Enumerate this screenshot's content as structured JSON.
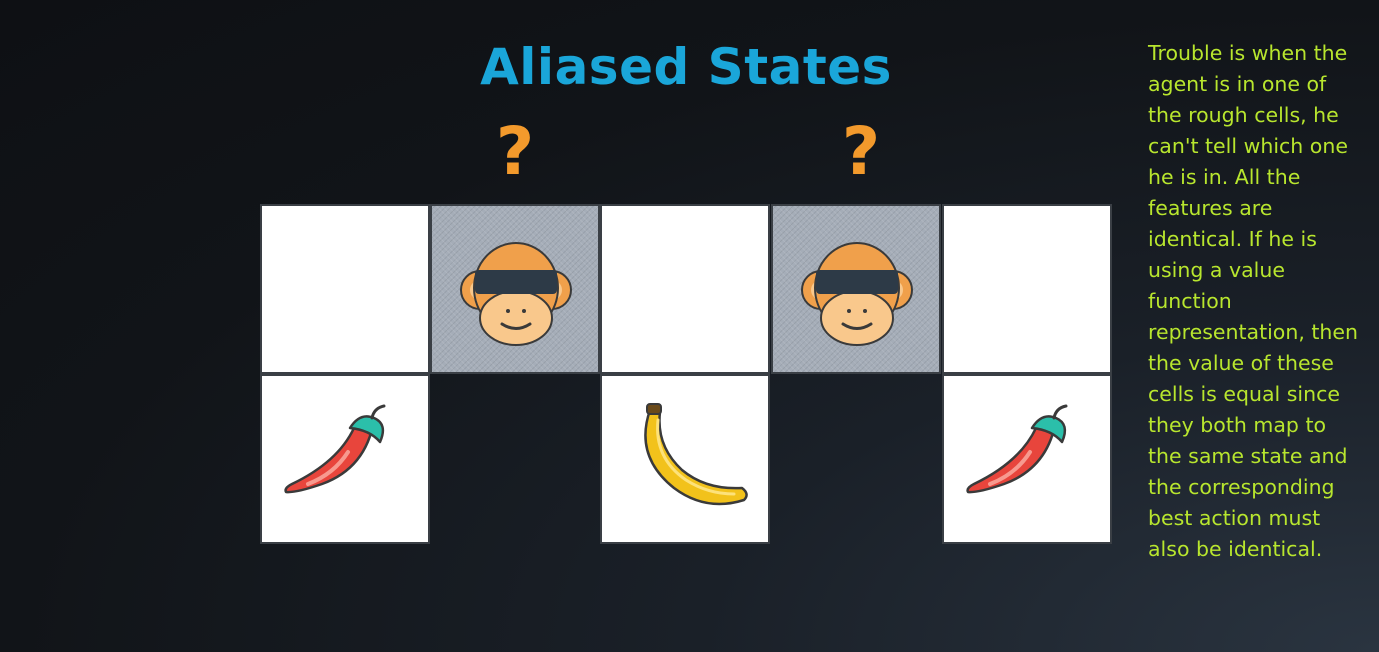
{
  "slide": {
    "title": "Aliased States",
    "question_mark": "?",
    "note": "Trouble is when the agent is in one of the rough cells, he can't tell which one he is in. All the features are identical. If he is using a value function representation, then the value of these cells is equal since they both map to the same state and the corresponding best action must also be identical."
  },
  "grid": {
    "top_row": [
      "empty",
      "rough-monkey",
      "empty",
      "rough-monkey",
      "empty"
    ],
    "bottom_row": [
      "chili-pepper",
      "none",
      "banana",
      "none",
      "chili-pepper"
    ]
  },
  "colors": {
    "title": "#1aa6d9",
    "question_mark": "#f39a2c",
    "note_text": "#b8e62e",
    "rough_cell": "#a5adb8"
  }
}
